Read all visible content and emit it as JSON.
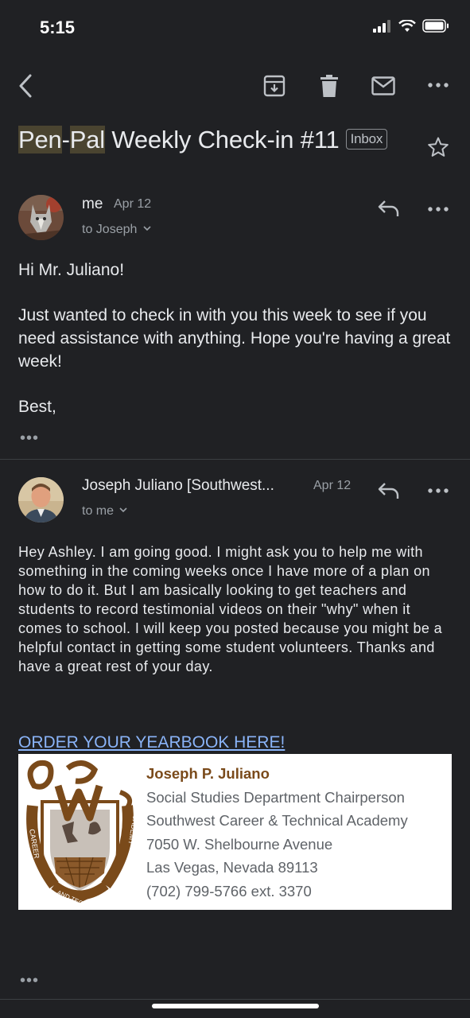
{
  "status": {
    "time": "5:15"
  },
  "thread": {
    "subject_parts": [
      "Pen",
      "-",
      "Pal",
      " Weekly Check-in #11"
    ],
    "label": "Inbox"
  },
  "message1": {
    "sender": "me",
    "date": "Apr 12",
    "to": "to Joseph",
    "paragraphs": [
      "Hi Mr. Juliano!",
      "Just wanted to check in with you this week to see if you need assistance with anything. Hope you're having a great week!",
      "Best,"
    ],
    "more": "•••"
  },
  "message2": {
    "sender": "Joseph Juliano [Southwest...",
    "date": "Apr 12",
    "to": "to me",
    "body": "Hey Ashley. I am going good. I might ask you to help me with something in the coming weeks once I have more of a plan on how to do it. But I am basically looking to get teachers and students to record testimonial videos on their \"why\" when it comes to school. I will keep you posted because you might be a helpful contact in getting some student volunteers. Thanks and have a great rest of your day.",
    "link": "ORDER YOUR YEARBOOK HERE!",
    "signature": {
      "name": "Joseph P. Juliano",
      "lines": [
        "Social Studies Department Chairperson",
        "Southwest Career & Technical Academy",
        "7050 W. Shelbourne Avenue",
        "Las Vegas, Nevada 89113",
        "(702) 799-5766 ext. 3370"
      ],
      "logo_text_left": "CAREER",
      "logo_text_right": "ACADEMY",
      "logo_text_bottom": "AND TECHNICAL"
    },
    "more": "•••"
  }
}
